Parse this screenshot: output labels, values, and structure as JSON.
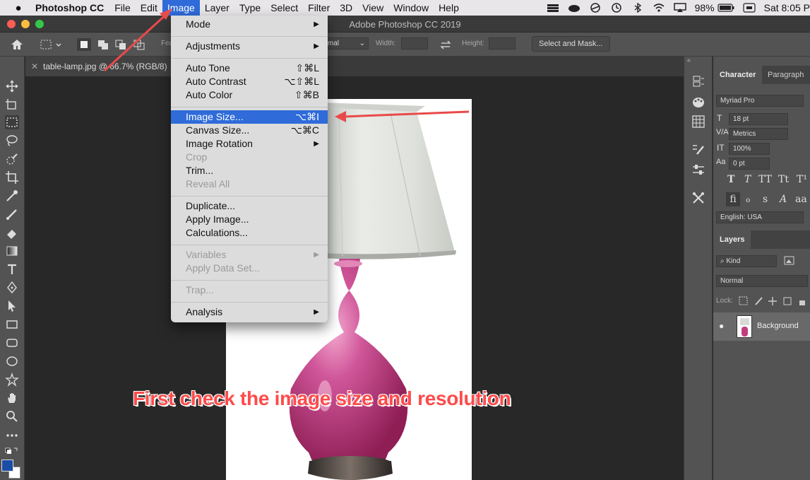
{
  "menubar": {
    "app_name": "Photoshop CC",
    "items": [
      "File",
      "Edit",
      "Image",
      "Layer",
      "Type",
      "Select",
      "Filter",
      "3D",
      "View",
      "Window",
      "Help"
    ],
    "active_item": "Image",
    "battery": "98%",
    "clock": "Sat 8:05 P"
  },
  "window": {
    "title": "Adobe Photoshop CC 2019"
  },
  "options": {
    "feather_label": "Fea",
    "style_value": "ormal",
    "width_label": "Width:",
    "height_label": "Height:",
    "select_mask_label": "Select and Mask..."
  },
  "document": {
    "tab_title": "table-lamp.jpg @ 66.7% (RGB/8)"
  },
  "image_menu": {
    "items": [
      {
        "label": "Mode",
        "shortcut": "",
        "submenu": true,
        "disabled": false
      },
      {
        "label": "Adjustments",
        "shortcut": "",
        "submenu": true,
        "disabled": false
      },
      {
        "label": "Auto Tone",
        "shortcut": "⇧⌘L",
        "submenu": false,
        "disabled": false
      },
      {
        "label": "Auto Contrast",
        "shortcut": "⌥⇧⌘L",
        "submenu": false,
        "disabled": false
      },
      {
        "label": "Auto Color",
        "shortcut": "⇧⌘B",
        "submenu": false,
        "disabled": false
      },
      {
        "label": "Image Size...",
        "shortcut": "⌥⌘I",
        "submenu": false,
        "disabled": false,
        "highlighted": true
      },
      {
        "label": "Canvas Size...",
        "shortcut": "⌥⌘C",
        "submenu": false,
        "disabled": false
      },
      {
        "label": "Image Rotation",
        "shortcut": "",
        "submenu": true,
        "disabled": false
      },
      {
        "label": "Crop",
        "shortcut": "",
        "submenu": false,
        "disabled": true
      },
      {
        "label": "Trim...",
        "shortcut": "",
        "submenu": false,
        "disabled": false
      },
      {
        "label": "Reveal All",
        "shortcut": "",
        "submenu": false,
        "disabled": true
      },
      {
        "label": "Duplicate...",
        "shortcut": "",
        "submenu": false,
        "disabled": false
      },
      {
        "label": "Apply Image...",
        "shortcut": "",
        "submenu": false,
        "disabled": false
      },
      {
        "label": "Calculations...",
        "shortcut": "",
        "submenu": false,
        "disabled": false
      },
      {
        "label": "Variables",
        "shortcut": "",
        "submenu": true,
        "disabled": true
      },
      {
        "label": "Apply Data Set...",
        "shortcut": "",
        "submenu": false,
        "disabled": true
      },
      {
        "label": "Trap...",
        "shortcut": "",
        "submenu": false,
        "disabled": true
      },
      {
        "label": "Analysis",
        "shortcut": "",
        "submenu": true,
        "disabled": false
      }
    ]
  },
  "character_panel": {
    "tab_character": "Character",
    "tab_paragraph": "Paragraph",
    "font_family": "Myriad Pro",
    "font_size": "18 pt",
    "kerning": "Metrics",
    "vertical_scale": "100%",
    "baseline_shift": "0 pt",
    "language": "English: USA"
  },
  "layers_panel": {
    "tab_label": "Layers",
    "filter_kind": "Kind",
    "blend_mode": "Normal",
    "lock_label": "Lock:",
    "layer_name": "Background"
  },
  "annotation": {
    "caption": "First check the image size and resolution"
  },
  "colors": {
    "accent": "#2f6bd9",
    "arrow": "#e94a4a",
    "lamp_pink": "#c53c7c"
  }
}
